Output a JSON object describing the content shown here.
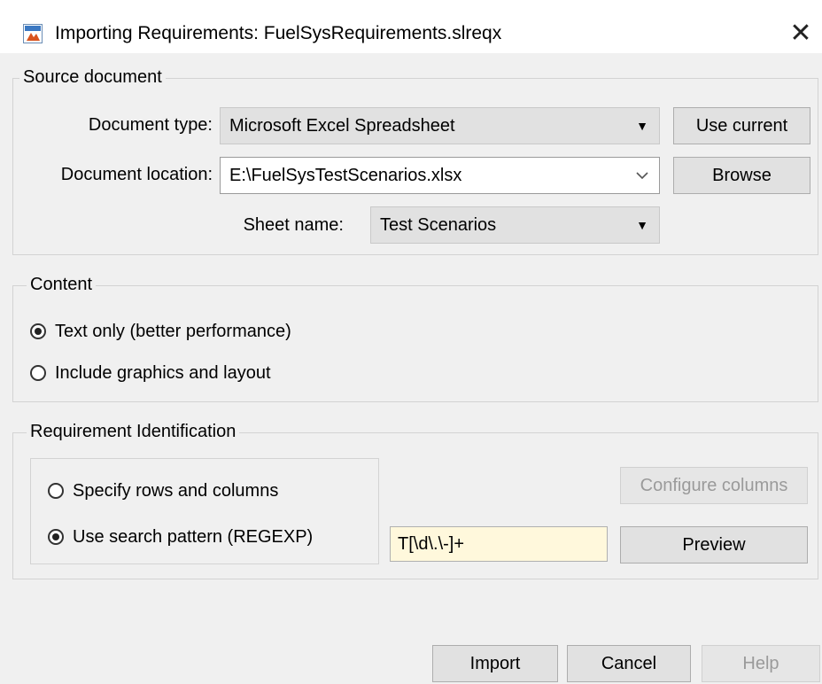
{
  "window": {
    "title": "Importing Requirements: FuelSysRequirements.slreqx",
    "close_glyph": "✕",
    "icon": "matlab-app-icon"
  },
  "source_document": {
    "group_title": "Source document",
    "document_type_label": "Document type:",
    "document_type_value": "Microsoft Excel Spreadsheet",
    "use_current_label": "Use current",
    "document_location_label": "Document location:",
    "document_location_value": "E:\\FuelSysTestScenarios.xlsx",
    "browse_label": "Browse",
    "sheet_name_label": "Sheet name:",
    "sheet_name_value": "Test Scenarios"
  },
  "content": {
    "group_title": "Content",
    "options": [
      {
        "label": "Text only (better performance)",
        "checked": true
      },
      {
        "label": "Include graphics and layout",
        "checked": false
      }
    ]
  },
  "requirement_identification": {
    "group_title": "Requirement Identification",
    "options": [
      {
        "label": "Specify rows and columns",
        "checked": false
      },
      {
        "label": "Use search pattern (REGEXP)",
        "checked": true
      }
    ],
    "configure_columns_label": "Configure columns",
    "regex_value": "T[\\d\\.\\-]+",
    "preview_label": "Preview"
  },
  "footer": {
    "import_label": "Import",
    "cancel_label": "Cancel",
    "help_label": "Help"
  },
  "glyphs": {
    "dropdown_arrow": "▼",
    "chevron_down": "⌵"
  }
}
